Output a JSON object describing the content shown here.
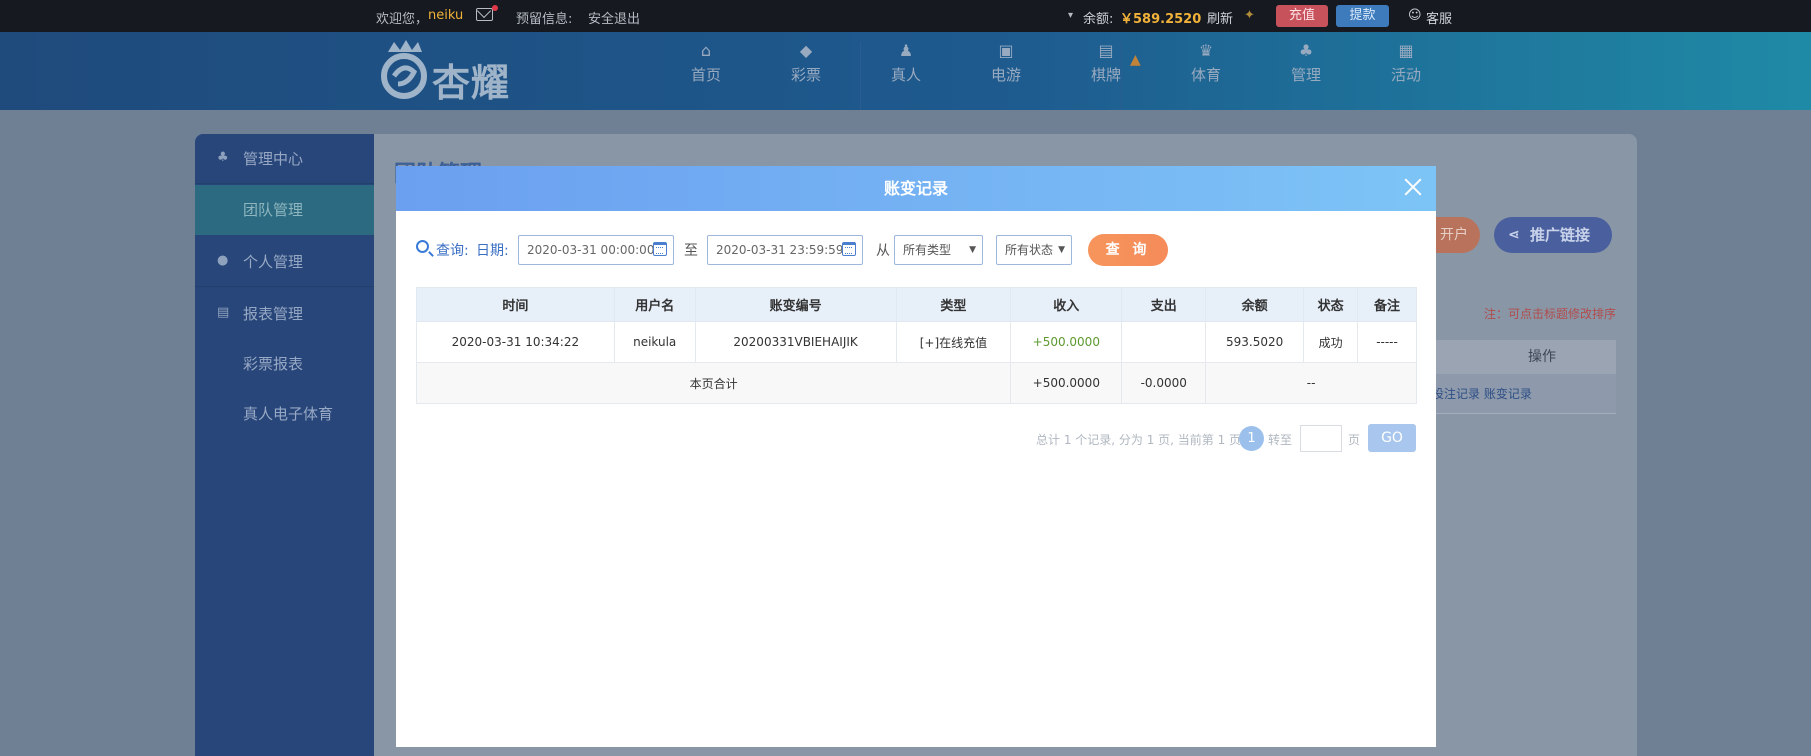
{
  "topbar": {
    "welcome": "欢迎您，",
    "username": "neiku",
    "reserved_info": "预留信息:",
    "logout": "安全退出",
    "balance_label": "余额:",
    "balance_value": "￥589.2520",
    "refresh": "刷新",
    "recharge": "充值",
    "withdraw": "提款",
    "service": "客服"
  },
  "brand": {
    "logo_text": "杏耀"
  },
  "nav": [
    {
      "label": "首页",
      "icon": "home-icon"
    },
    {
      "label": "彩票",
      "icon": "lottery-icon"
    },
    {
      "label": "真人",
      "icon": "live-icon"
    },
    {
      "label": "电游",
      "icon": "slot-icon"
    },
    {
      "label": "棋牌",
      "icon": "cards-icon"
    },
    {
      "label": "体育",
      "icon": "trophy-icon"
    },
    {
      "label": "管理",
      "icon": "users-icon"
    },
    {
      "label": "活动",
      "icon": "gift-icon"
    }
  ],
  "sidebar": {
    "items": [
      {
        "label": "管理中心"
      },
      {
        "label": "团队管理"
      },
      {
        "label": "个人管理"
      },
      {
        "label": "报表管理"
      },
      {
        "label": "彩票报表"
      },
      {
        "label": "真人电子体育"
      }
    ]
  },
  "background": {
    "page_title": "团队管理",
    "open_account": "开户",
    "promo_link": "推广链接",
    "hint": "注：可点击标题修改排序",
    "ops_header": "操作",
    "ops_links": "投注记录  账变记录"
  },
  "modal": {
    "title": "账变记录",
    "filter": {
      "query_label": "查询:",
      "date_label": "日期:",
      "start": "2020-03-31 00:00:00",
      "to": "至",
      "end": "2020-03-31 23:59:59",
      "from": "从",
      "type_select": "所有类型",
      "status_select": "所有状态",
      "query_button": "查 询"
    },
    "columns": [
      "时间",
      "用户名",
      "账变编号",
      "类型",
      "收入",
      "支出",
      "余额",
      "状态",
      "备注"
    ],
    "rows": [
      {
        "time": "2020-03-31 10:34:22",
        "user": "neikula",
        "id": "20200331VBIEHAIJIK",
        "type": "[+]在线充值",
        "income": "+500.0000",
        "expense": "",
        "balance": "593.5020",
        "status": "成功",
        "note": "-----"
      }
    ],
    "summary": {
      "label": "本页合计",
      "income": "+500.0000",
      "expense": "-0.0000",
      "balance": "--"
    },
    "pager": {
      "info": "总计 1 个记录, 分为 1 页, 当前第 1 页",
      "current": "1",
      "jump_label": "转至",
      "page_unit": "页",
      "go": "GO"
    }
  }
}
